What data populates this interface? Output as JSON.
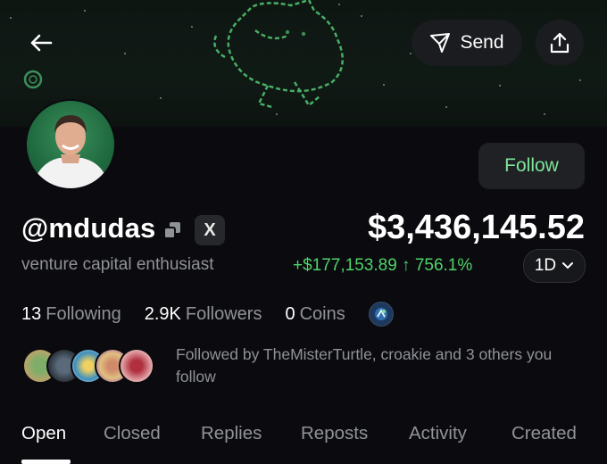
{
  "header": {
    "send_label": "Send"
  },
  "profile": {
    "handle": "@mdudas",
    "bio": "venture capital enthusiast",
    "x_badge": "X",
    "follow_label": "Follow"
  },
  "portfolio": {
    "balance": "$3,436,145.52",
    "pnl": "+$177,153.89 ↑ 756.1%",
    "range": "1D"
  },
  "stats": [
    {
      "value": "13",
      "label": "Following"
    },
    {
      "value": "2.9K",
      "label": "Followers"
    },
    {
      "value": "0",
      "label": "Coins"
    }
  ],
  "followed_by": {
    "text": "Followed by TheMisterTurtle, croakie and 3 others you follow"
  },
  "tabs": [
    {
      "label": "Open"
    },
    {
      "label": "Closed"
    },
    {
      "label": "Replies"
    },
    {
      "label": "Reposts"
    },
    {
      "label": "Activity"
    },
    {
      "label": "Created"
    }
  ],
  "colors": {
    "background": "#0b0b0f",
    "accent_green": "#4fd36a",
    "follow_text": "#7ee59a",
    "muted_text": "#8f9297"
  },
  "icons": [
    "arrow-left-icon",
    "send-icon",
    "share-icon",
    "copy-icon",
    "chevron-down-icon",
    "coin-icon"
  ]
}
